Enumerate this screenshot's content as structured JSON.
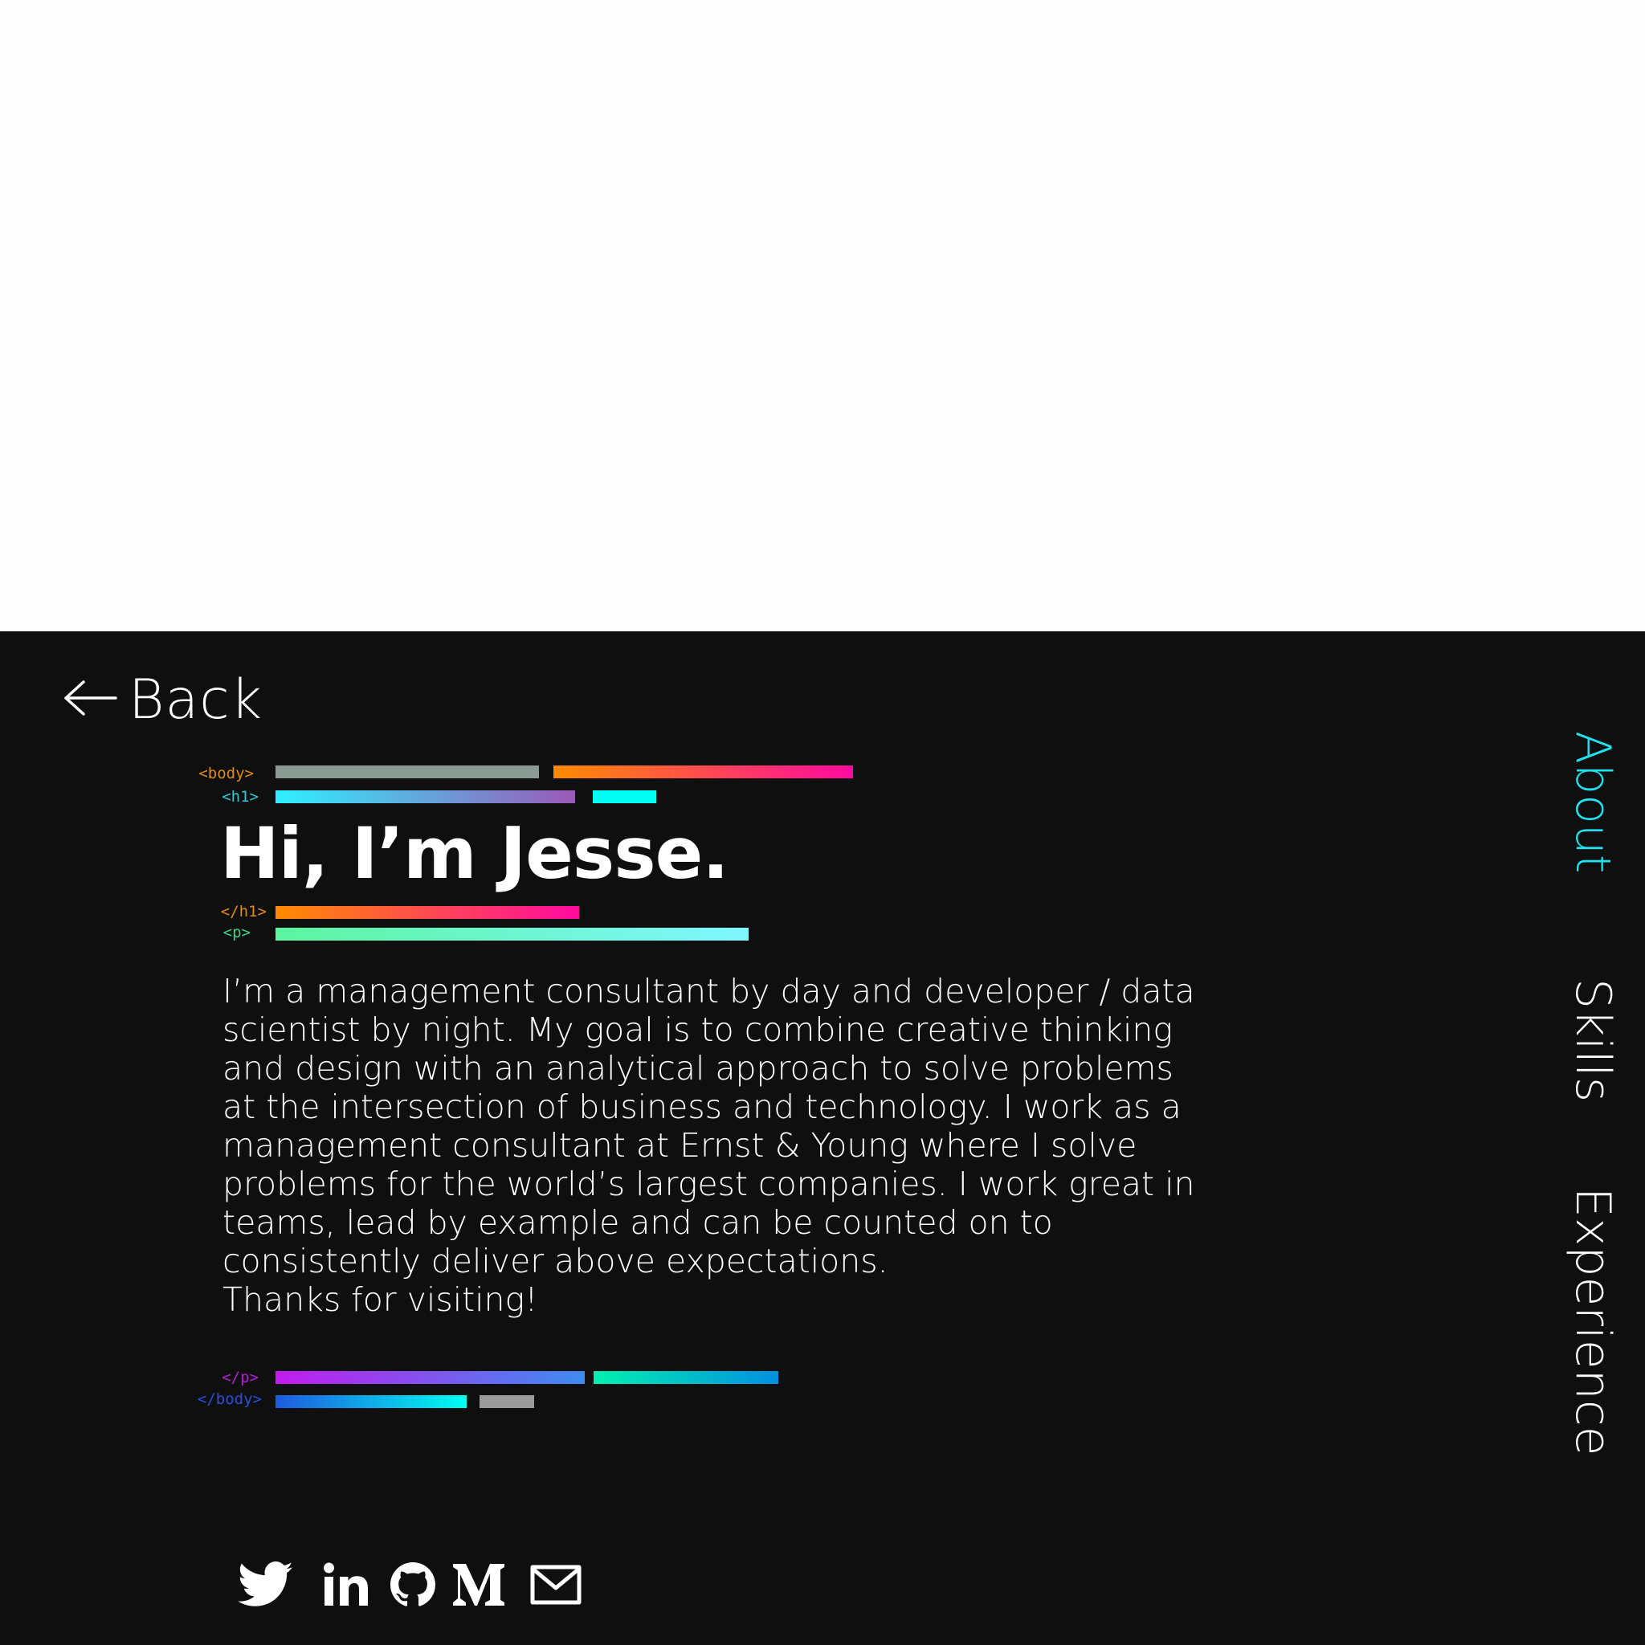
{
  "back": {
    "label": "Back"
  },
  "tags": {
    "body_open": "<body>",
    "h1_open": "<h1>",
    "h1_close": "</h1>",
    "p_open": "<p>",
    "p_close": "</p>",
    "body_close": "</body>"
  },
  "heading": "Hi, I’m Jesse.",
  "bio": "I’m a management consultant by day and developer / data\nscientist by night. My goal is to combine creative thinking\nand design with an analytical approach to solve problems\nat the intersection of business and technology. I work as a\nmanagement consultant at Ernst & Young where I solve\nproblems for the world’s largest companies. I work great in\nteams, lead by example and can be counted on to\nconsistently deliver above expectations.\nThanks for visiting!",
  "nav": [
    {
      "label": "About",
      "active": true
    },
    {
      "label": "Skills",
      "active": false
    },
    {
      "label": "Experience",
      "active": false
    }
  ],
  "social": [
    {
      "icon": "twitter-icon"
    },
    {
      "icon": "linkedin-icon"
    },
    {
      "icon": "github-icon"
    },
    {
      "icon": "medium-icon"
    },
    {
      "icon": "mail-icon"
    }
  ],
  "colors": {
    "background": "#0f0f0f",
    "accent": "#1fe3f0",
    "text": "#ffffff",
    "tag_body_open": "#e08a1c",
    "tag_h1_open": "#2ec9d6",
    "tag_h1_close": "#e08a1c",
    "tag_p_open": "#3fcf8a",
    "tag_p_close": "#b321d6",
    "tag_body_close": "#2d4fd6"
  }
}
